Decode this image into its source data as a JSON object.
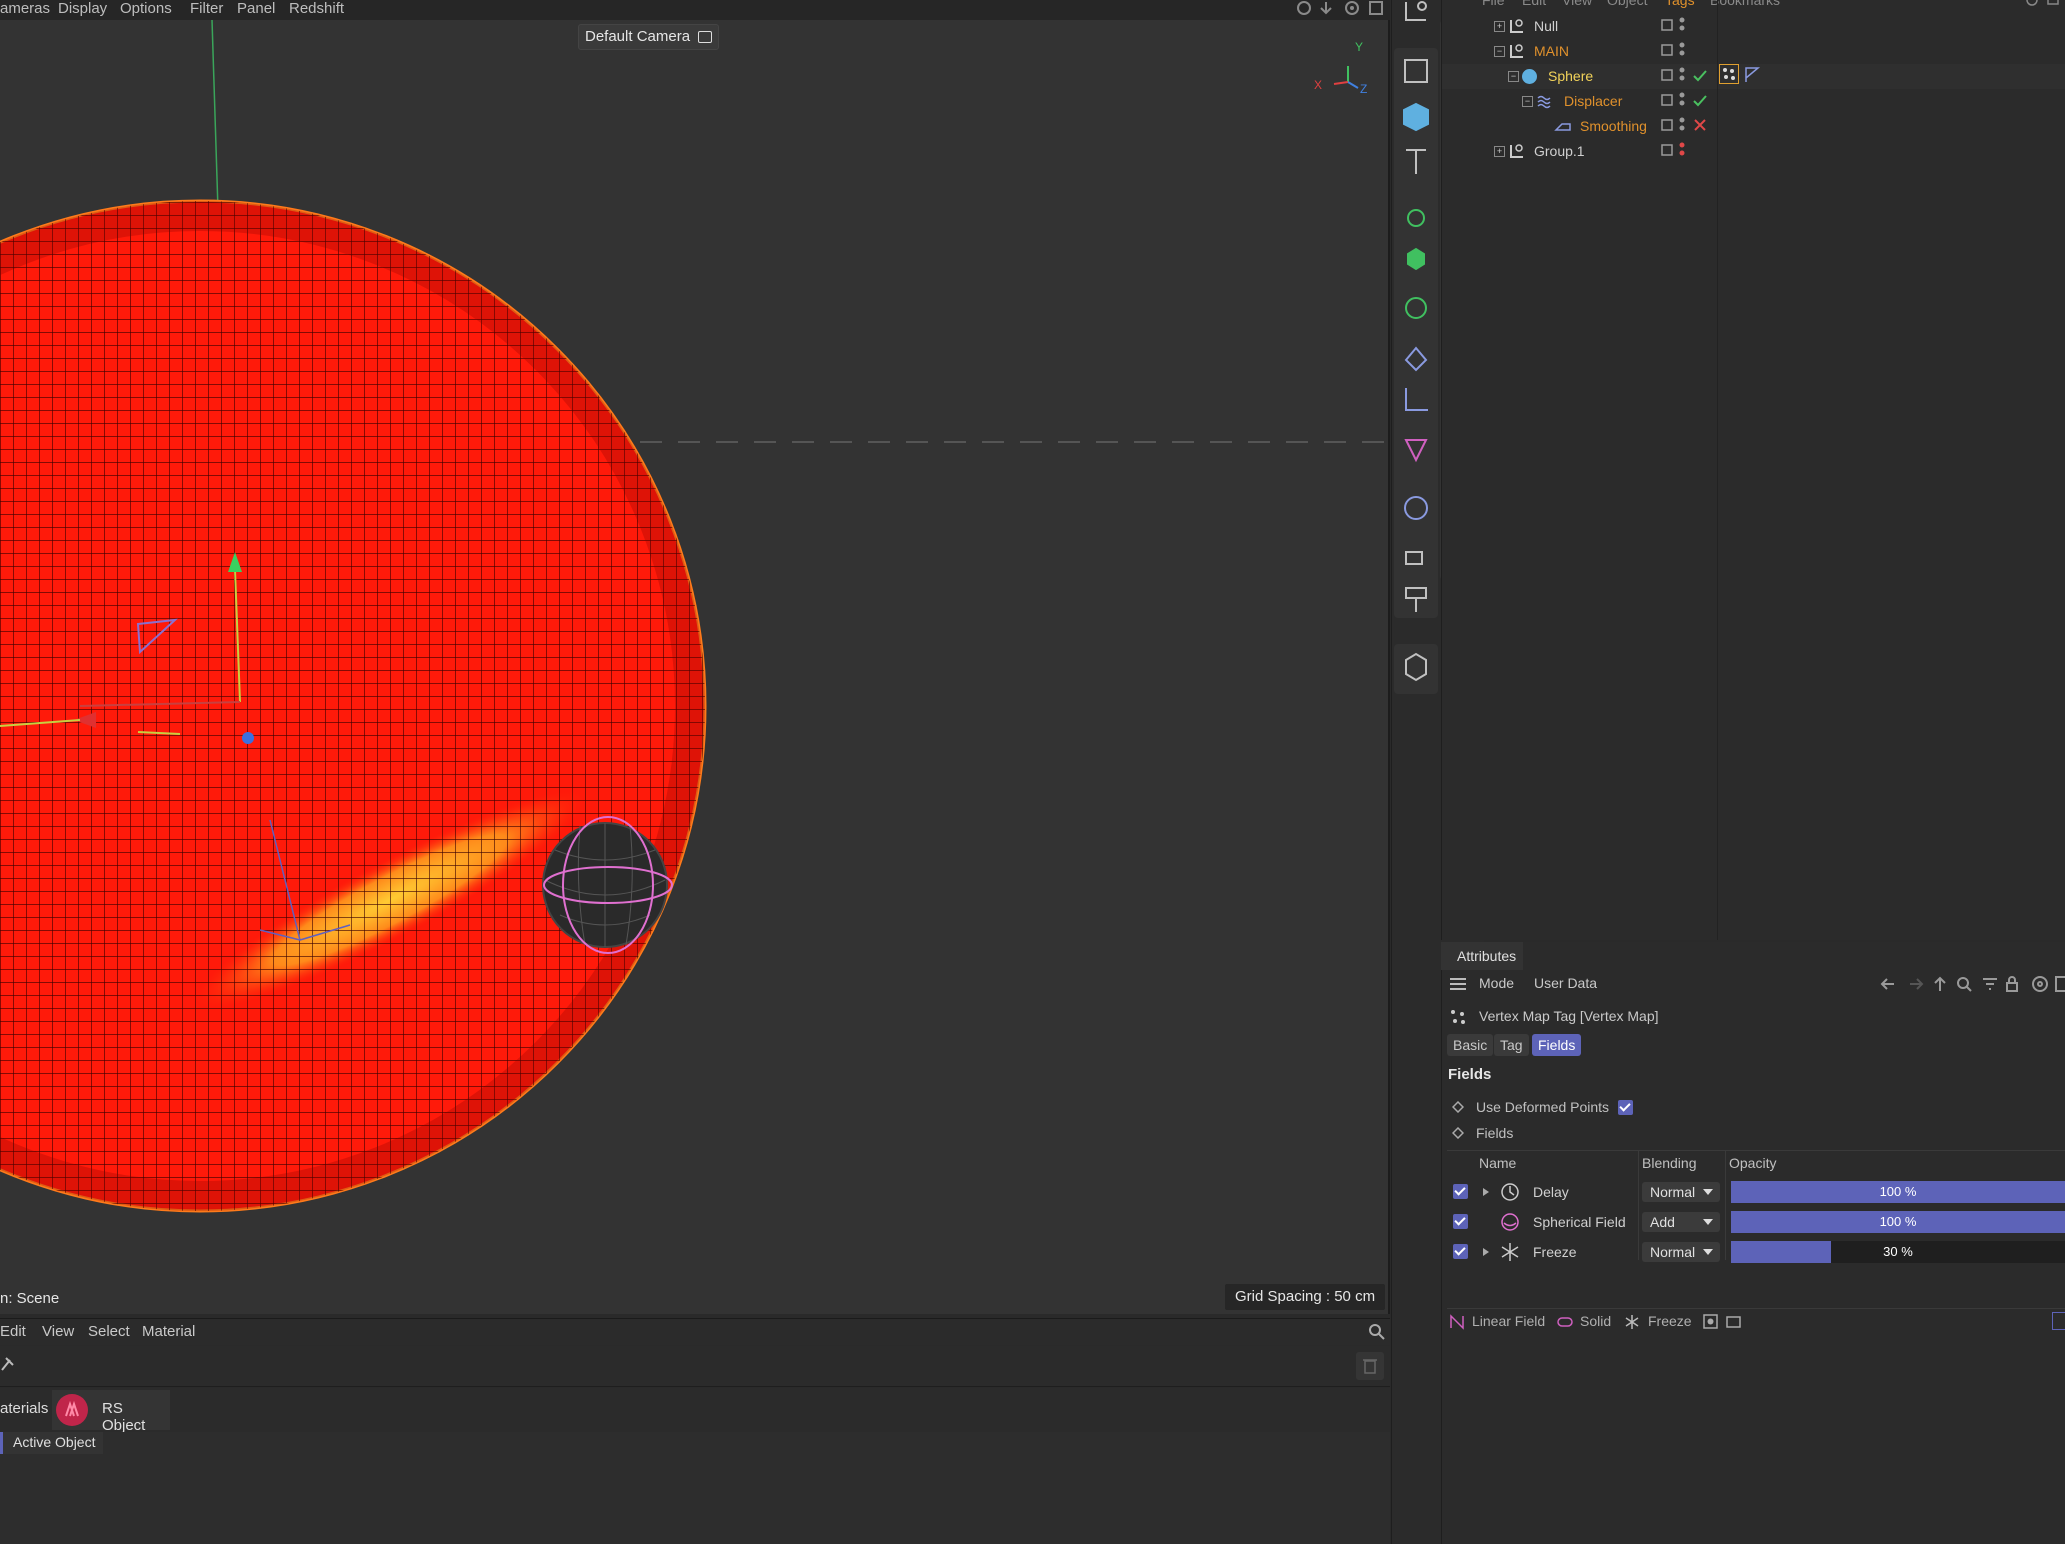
{
  "viewport": {
    "menu": [
      "ameras",
      "Display",
      "Options",
      "Filter",
      "Panel",
      "Redshift"
    ],
    "camera_label": "Default Camera",
    "grid_spacing": "Grid Spacing : 50 cm",
    "scene_label": "n: Scene",
    "axis_labels": {
      "x": "X",
      "y": "Y",
      "z": "Z"
    }
  },
  "material_manager": {
    "menu": [
      "Edit",
      "View",
      "Select",
      "Material"
    ],
    "tab_materials": "aterials",
    "tab_rs_object": "RS Object",
    "filter_active_object": "Active Object"
  },
  "object_manager": {
    "menu": [
      "File",
      "Edit",
      "View",
      "Object",
      "Tags",
      "Bookmarks"
    ],
    "objects": [
      {
        "name": "Null",
        "color": "#d0d0d0"
      },
      {
        "name": "MAIN",
        "color": "#e0912c"
      },
      {
        "name": "Sphere",
        "color": "#f2d35a"
      },
      {
        "name": "Displacer",
        "color": "#e0912c"
      },
      {
        "name": "Smoothing",
        "color": "#e0912c"
      },
      {
        "name": "Group.1",
        "color": "#d0d0d0"
      }
    ]
  },
  "attributes": {
    "panel_title": "Attributes",
    "mode_menu": [
      "Mode",
      "User Data"
    ],
    "object_title": "Vertex Map Tag [Vertex Map]",
    "tabs": [
      "Basic",
      "Tag",
      "Fields"
    ],
    "active_tab": "Fields",
    "section_title": "Fields",
    "use_deformed_points_label": "Use Deformed Points",
    "use_deformed_points": true,
    "fields_label": "Fields",
    "columns": [
      "Name",
      "Blending",
      "Opacity"
    ],
    "field_rows": [
      {
        "name": "Delay",
        "blending": "Normal",
        "opacity_text": "100 %",
        "opacity": 1.0
      },
      {
        "name": "Spherical Field",
        "blending": "Add",
        "opacity_text": "100 %",
        "opacity": 1.0
      },
      {
        "name": "Freeze",
        "blending": "Normal",
        "opacity_text": "30 %",
        "opacity": 0.3
      }
    ],
    "bottom_buttons": [
      "Linear Field",
      "Solid",
      "Freeze"
    ]
  },
  "colors": {
    "accent": "#5d63b8",
    "sphere": "#ff1a0a",
    "highlight": "#ffb020",
    "active_text": "#e0912c"
  }
}
